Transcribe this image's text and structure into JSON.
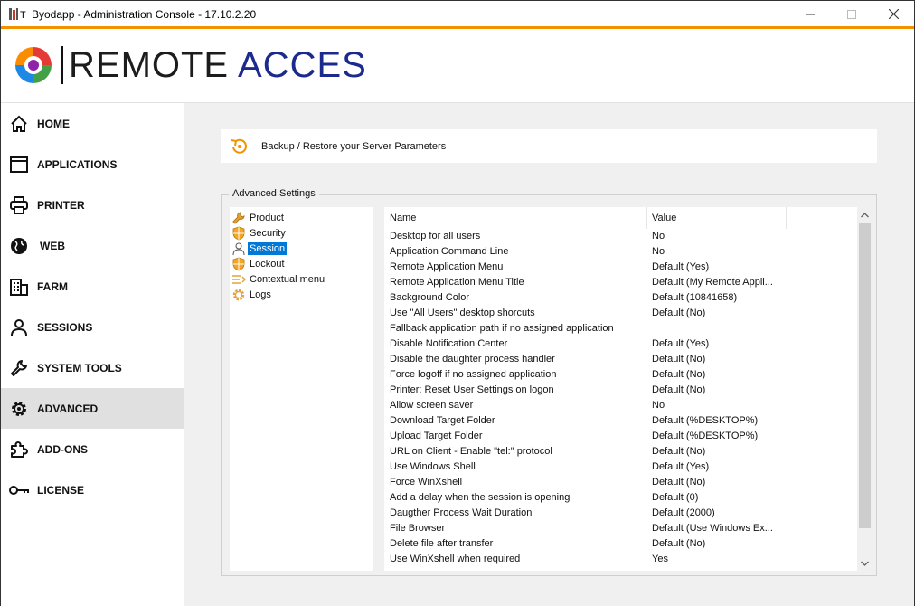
{
  "window": {
    "title": "Byodapp - Administration Console - 17.10.2.20",
    "title_prefix": "T"
  },
  "logo": {
    "text_dark": "REMOTE ",
    "text_blue": "ACCES"
  },
  "sidebar": {
    "items": [
      {
        "label": "HOME",
        "icon": "home-icon"
      },
      {
        "label": "APPLICATIONS",
        "icon": "window-icon"
      },
      {
        "label": "PRINTER",
        "icon": "printer-icon"
      },
      {
        "label": "WEB",
        "icon": "globe-icon"
      },
      {
        "label": "FARM",
        "icon": "building-icon"
      },
      {
        "label": "SESSIONS",
        "icon": "user-icon"
      },
      {
        "label": "SYSTEM TOOLS",
        "icon": "wrench-icon"
      },
      {
        "label": "ADVANCED",
        "icon": "gear-icon",
        "active": true
      },
      {
        "label": "ADD-ONS",
        "icon": "puzzle-icon"
      },
      {
        "label": "LICENSE",
        "icon": "key-icon"
      }
    ]
  },
  "backup": {
    "label": "Backup / Restore your Server Parameters"
  },
  "advanced": {
    "group_title": "Advanced Settings",
    "tree": [
      {
        "label": "Product",
        "icon": "wrench-icon"
      },
      {
        "label": "Security",
        "icon": "shield-icon"
      },
      {
        "label": "Session",
        "icon": "user-icon",
        "selected": true
      },
      {
        "label": "Lockout",
        "icon": "shield-icon"
      },
      {
        "label": "Contextual menu",
        "icon": "menu-icon"
      },
      {
        "label": "Logs",
        "icon": "gear-icon"
      }
    ],
    "columns": {
      "name": "Name",
      "value": "Value"
    },
    "rows": [
      {
        "name": "Desktop for all users",
        "value": "No"
      },
      {
        "name": "Application Command Line",
        "value": "No"
      },
      {
        "name": "Remote Application Menu",
        "value": "Default (Yes)"
      },
      {
        "name": "Remote Application Menu Title",
        "value": "Default (My Remote Appli..."
      },
      {
        "name": "Background Color",
        "value": "Default (10841658)"
      },
      {
        "name": "Use \"All Users\" desktop shorcuts",
        "value": "Default (No)"
      },
      {
        "name": "Fallback application path if no assigned application",
        "value": ""
      },
      {
        "name": "Disable Notification Center",
        "value": "Default (Yes)"
      },
      {
        "name": "Disable the daughter process handler",
        "value": "Default (No)"
      },
      {
        "name": "Force logoff if no assigned application",
        "value": "Default (No)"
      },
      {
        "name": "Printer: Reset User Settings on logon",
        "value": "Default (No)"
      },
      {
        "name": "Allow screen saver",
        "value": "No"
      },
      {
        "name": "Download Target Folder",
        "value": "Default (%DESKTOP%)"
      },
      {
        "name": "Upload Target Folder",
        "value": "Default (%DESKTOP%)"
      },
      {
        "name": "URL on Client - Enable \"tel:\" protocol",
        "value": "Default (No)"
      },
      {
        "name": "Use Windows Shell",
        "value": "Default (Yes)"
      },
      {
        "name": "Force WinXshell",
        "value": "Default (No)"
      },
      {
        "name": "Add a delay when the session is opening",
        "value": "Default (0)"
      },
      {
        "name": "Daugther Process Wait Duration",
        "value": "Default (2000)"
      },
      {
        "name": "File Browser",
        "value": "Default (Use Windows Ex..."
      },
      {
        "name": "Delete file after transfer",
        "value": "Default (No)"
      },
      {
        "name": "Use WinXshell when required",
        "value": "Yes"
      }
    ]
  },
  "colors": {
    "accent": "#f39200",
    "selection": "#0078d7",
    "logo_blue": "#1b2a8c"
  }
}
